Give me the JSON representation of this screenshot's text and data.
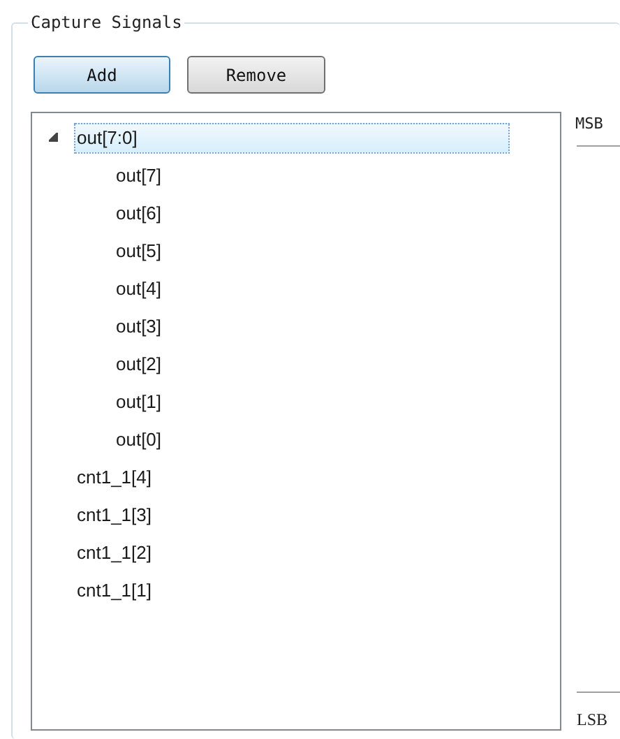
{
  "group": {
    "title": "Capture Signals"
  },
  "buttons": [
    {
      "label": "Add",
      "selected": true
    },
    {
      "label": "Remove",
      "selected": false
    }
  ],
  "tree": [
    {
      "label": "out[7:0]",
      "selected": true,
      "expanded": true,
      "children": [
        {
          "label": "out[7]",
          "selected": false
        },
        {
          "label": "out[6]",
          "selected": false
        },
        {
          "label": "out[5]",
          "selected": false
        },
        {
          "label": "out[4]",
          "selected": false
        },
        {
          "label": "out[3]",
          "selected": false
        },
        {
          "label": "out[2]",
          "selected": false
        },
        {
          "label": "out[1]",
          "selected": false
        },
        {
          "label": "out[0]",
          "selected": false
        }
      ]
    },
    {
      "label": "cnt1_1[4]",
      "selected": false
    },
    {
      "label": "cnt1_1[3]",
      "selected": false
    },
    {
      "label": "cnt1_1[2]",
      "selected": false
    },
    {
      "label": "cnt1_1[1]",
      "selected": false
    }
  ],
  "order": {
    "top": "MSB",
    "bottom": "LSB"
  }
}
